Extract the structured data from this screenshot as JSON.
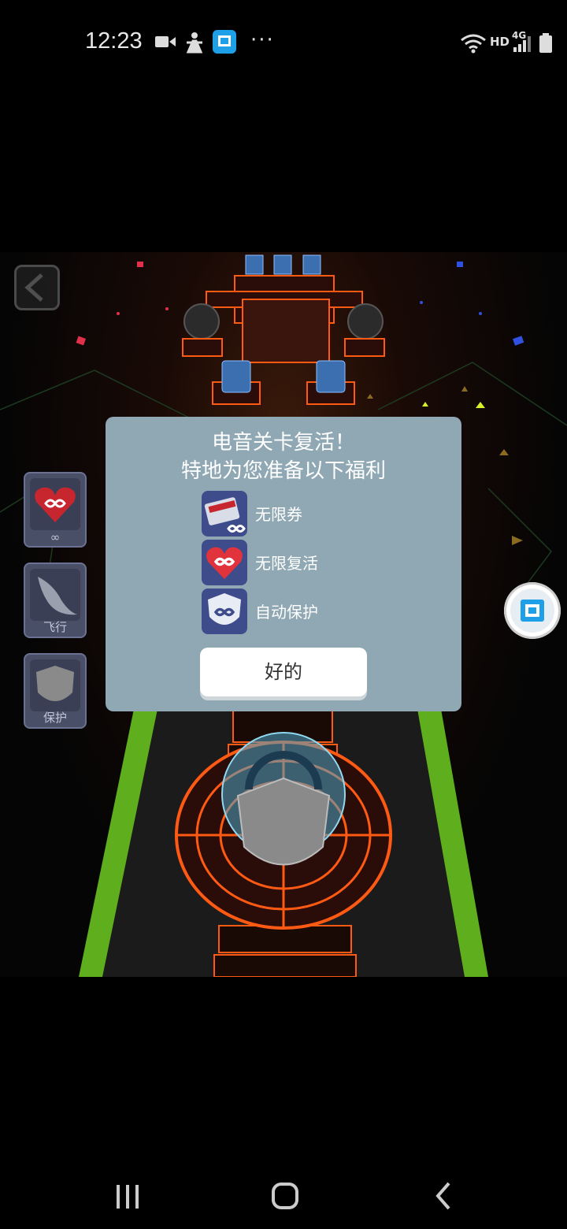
{
  "status_bar": {
    "time": "12:23",
    "icons": [
      "video-camera-icon",
      "accessibility-icon",
      "app-icon",
      "more-dots-icon",
      "wifi-icon",
      "signal-icon",
      "battery-icon"
    ],
    "more": "···",
    "hd": "HD",
    "network": "4G"
  },
  "game": {
    "power_ups": [
      {
        "name": "infinite-hearts",
        "label": "∞"
      },
      {
        "name": "fly",
        "label": "飞行"
      },
      {
        "name": "protect",
        "label": "保护"
      }
    ]
  },
  "dialog": {
    "title_line1": "电音关卡复活！",
    "title_line2": "特地为您准备以下福利",
    "benefits": [
      {
        "label": "无限券",
        "icon": "ticket-infinity-icon"
      },
      {
        "label": "无限复活",
        "icon": "heart-infinity-icon"
      },
      {
        "label": "自动保护",
        "icon": "shield-infinity-icon"
      }
    ],
    "ok_label": "好的"
  },
  "colors": {
    "dialog_bg": "#8fa8b4",
    "icon_bg": "#3f4c8c",
    "track_green": "#5fae1e",
    "neon_orange": "#ff5a14"
  }
}
